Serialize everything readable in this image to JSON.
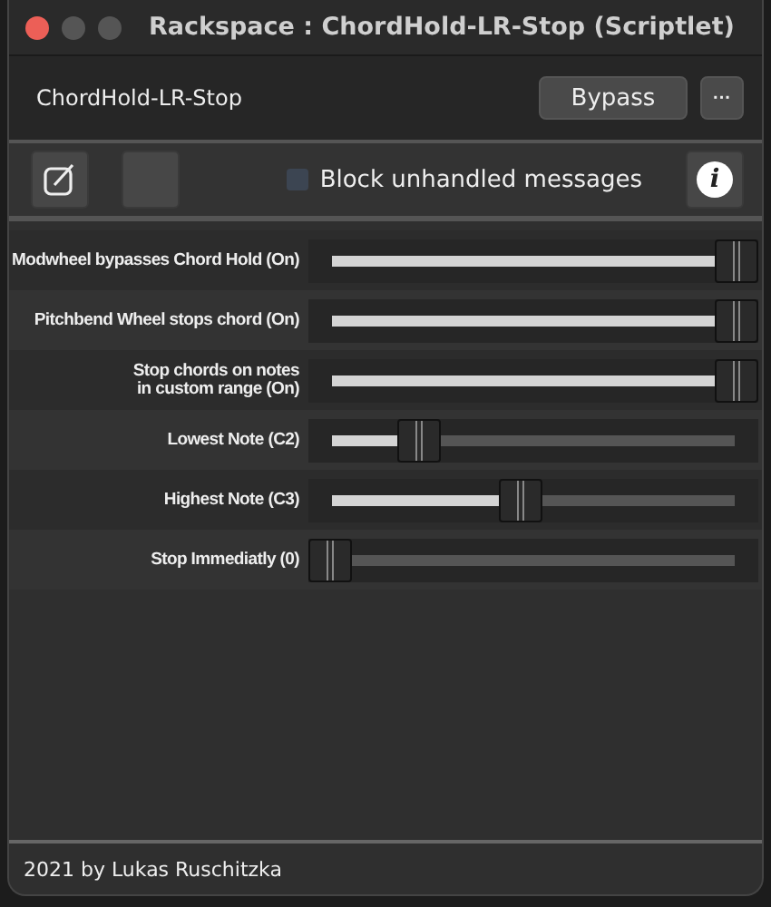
{
  "window": {
    "title": "Rackspace : ChordHold-LR-Stop (Scriptlet)"
  },
  "header": {
    "name": "ChordHold-LR-Stop",
    "bypass": "Bypass",
    "more": "···"
  },
  "toolbar": {
    "block_unhandled": {
      "label": "Block unhandled messages",
      "checked": false
    },
    "info": "i"
  },
  "params": [
    {
      "label": "Modwheel bypasses Chord Hold (On)",
      "level": 1
    },
    {
      "label": "Pitchbend Wheel stops chord (On)",
      "level": 1
    },
    {
      "label": "Stop chords on notes\nin custom range (On)",
      "level": 1
    },
    {
      "label": "Lowest Note (C2)",
      "level": 0.22
    },
    {
      "label": "Highest Note (C3)",
      "level": 0.47
    },
    {
      "label": "Stop Immediatly (0)",
      "level": 0
    }
  ],
  "footer": "2021 by Lukas Ruschitzka"
}
